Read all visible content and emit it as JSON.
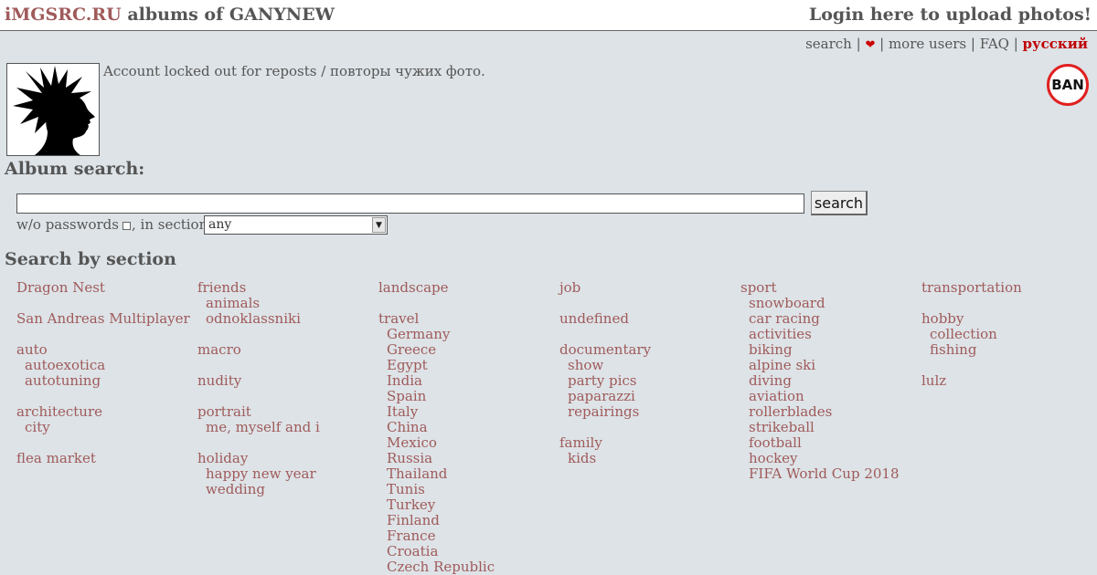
{
  "header": {
    "brand": "iMGSRC.RU",
    "title_rest": " albums of GANYNEW",
    "login": "Login here to upload photos!"
  },
  "nav": {
    "search": "search",
    "heart": "❤",
    "more_users": "more users",
    "faq": "FAQ",
    "language": "русский",
    "sep": " | "
  },
  "profile": {
    "status": "Account locked out for reposts / повторы чужих фото.",
    "ban_badge": "BAN"
  },
  "album_search": {
    "heading": "Album search:",
    "input_value": "",
    "button": "search",
    "wo_passwords": "w/o passwords",
    "in_section": ", in section:",
    "section_value": "any"
  },
  "sections": {
    "heading": "Search by section",
    "columns": [
      [
        "Dragon Nest",
        "",
        "San Andreas Multiplayer",
        "",
        "auto",
        ">autoexotica",
        ">autotuning",
        "",
        "architecture",
        ">city",
        "",
        "flea market"
      ],
      [
        "friends",
        ">animals",
        ">odnoklassniki",
        "",
        "macro",
        "",
        "nudity",
        "",
        "portrait",
        ">me, myself and i",
        "",
        "holiday",
        ">happy new year",
        ">wedding"
      ],
      [
        "landscape",
        "",
        "travel",
        ">Germany",
        ">Greece",
        ">Egypt",
        ">India",
        ">Spain",
        ">Italy",
        ">China",
        ">Mexico",
        ">Russia",
        ">Thailand",
        ">Tunis",
        ">Turkey",
        ">Finland",
        ">France",
        ">Croatia",
        ">Czech Republic"
      ],
      [
        "job",
        "",
        "undefined",
        "",
        "documentary",
        ">show",
        ">party pics",
        ">paparazzi",
        ">repairings",
        "",
        "family",
        ">kids"
      ],
      [
        "sport",
        ">snowboard",
        ">car racing",
        ">activities",
        ">biking",
        ">alpine ski",
        ">diving",
        ">aviation",
        ">rollerblades",
        ">strikeball",
        ">football",
        ">hockey",
        ">FIFA World Cup 2018"
      ],
      [
        "transportation",
        "",
        "hobby",
        ">collection",
        ">fishing",
        "",
        "lulz"
      ]
    ]
  }
}
